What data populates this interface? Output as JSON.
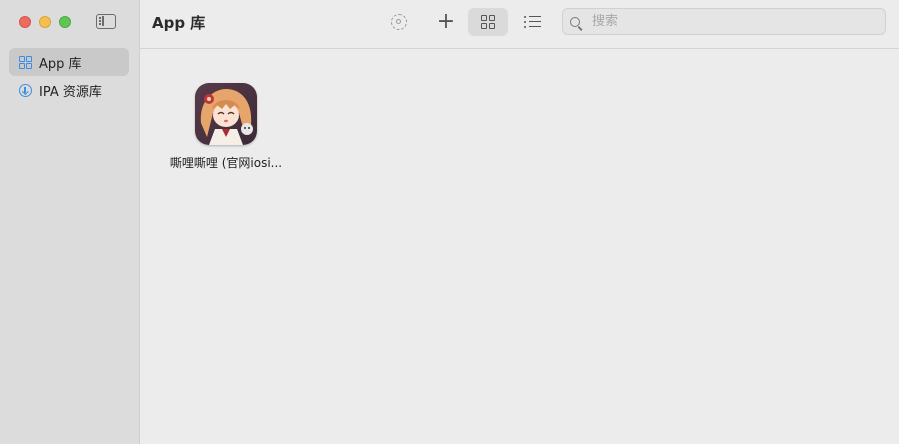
{
  "window": {
    "title": "App 库"
  },
  "sidebar": {
    "items": [
      {
        "label": "App 库",
        "icon": "grid-icon",
        "active": true
      },
      {
        "label": "IPA 资源库",
        "icon": "download-circle-icon",
        "active": false
      }
    ]
  },
  "toolbar": {
    "settings_icon": "gear-icon",
    "add_icon": "plus-icon",
    "grid_view_icon": "grid-view-icon",
    "list_view_icon": "list-view-icon",
    "selected_view": "grid",
    "search_placeholder": "搜索",
    "search_value": ""
  },
  "apps": [
    {
      "name": "嘶哩嘶哩 (官网iosi..."
    }
  ],
  "colors": {
    "accent": "#3b8ee6",
    "sidebar_bg": "#dcdcdc",
    "content_bg": "#ececec",
    "selected_item_bg": "#c9c9c9"
  }
}
